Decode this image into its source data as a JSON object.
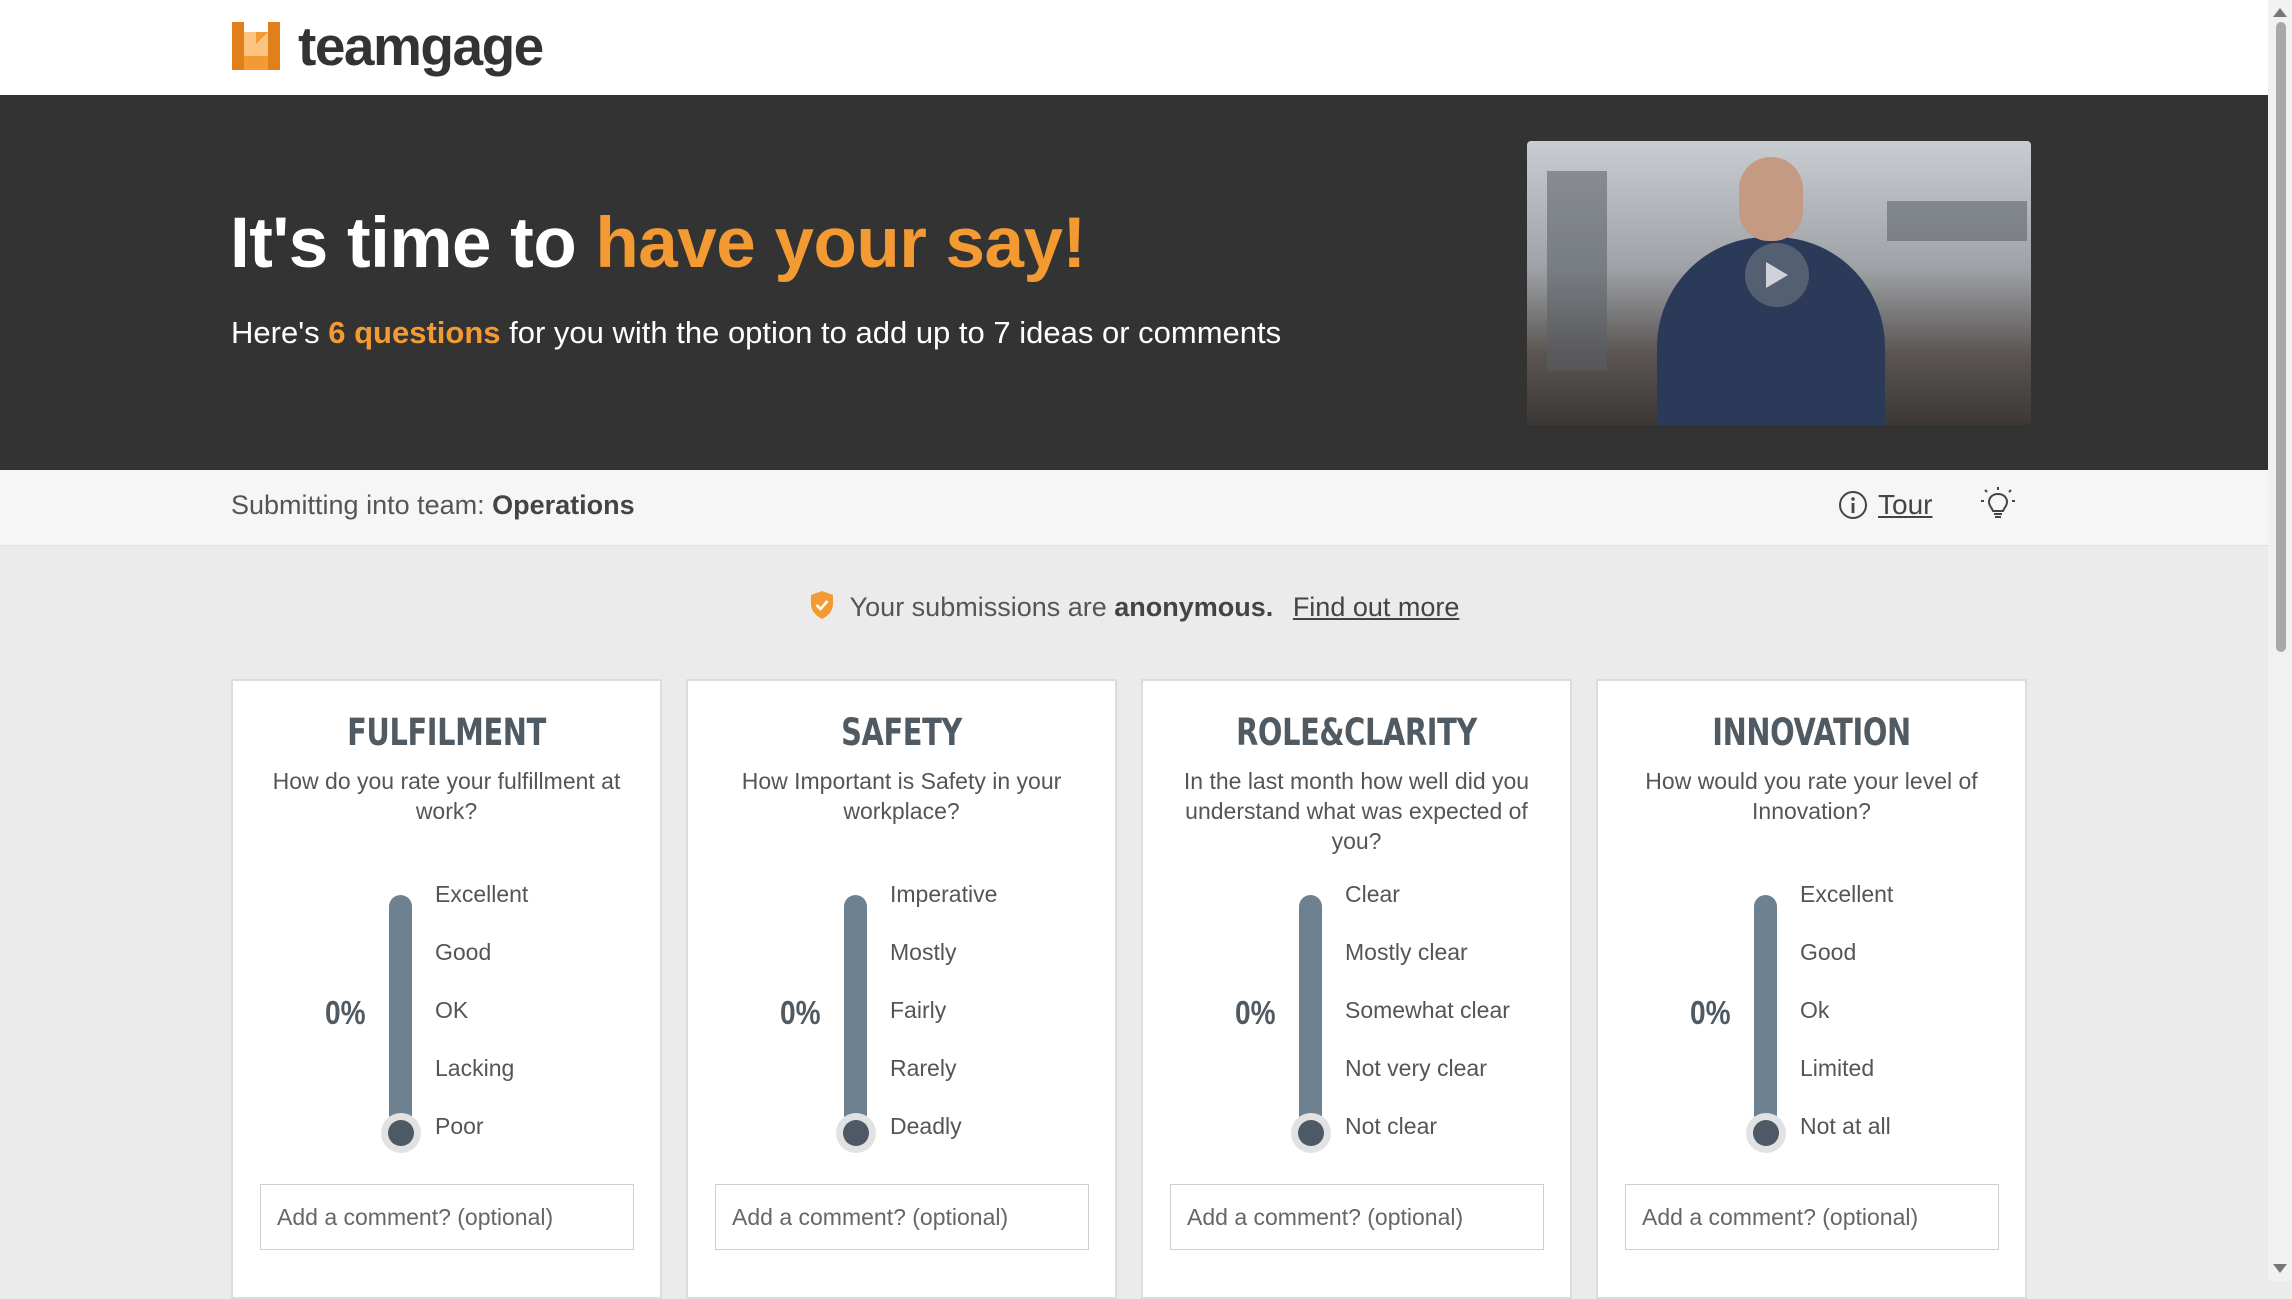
{
  "brand": {
    "name": "teamgage",
    "color_primary": "#f39b32",
    "color_dark": "#333333"
  },
  "hero": {
    "title_prefix": "It's time to ",
    "title_accent": "have your say!",
    "subtitle_prefix": "Here's ",
    "subtitle_highlight": "6 questions",
    "subtitle_suffix": " for you with the option to add up to 7 ideas or comments",
    "video_icon": "play-icon"
  },
  "teambar": {
    "label": "Submitting into team: ",
    "team": "Operations",
    "tour_label": "Tour",
    "tour_icon": "info-icon",
    "tips_icon": "lightbulb-icon"
  },
  "anonymity": {
    "text_prefix": "Your submissions are ",
    "text_bold": "anonymous.",
    "link": "Find out more",
    "icon": "shield-check-icon"
  },
  "questions": [
    {
      "title": "FULFILMENT",
      "question": "How do you rate your fulfillment at work?",
      "percent": "0%",
      "scale": [
        "Excellent",
        "Good",
        "OK",
        "Lacking",
        "Poor"
      ],
      "selected": "Poor",
      "comment_placeholder": "Add a comment? (optional)"
    },
    {
      "title": "SAFETY",
      "question": "How Important is Safety in your workplace?",
      "percent": "0%",
      "scale": [
        "Imperative",
        "Mostly",
        "Fairly",
        "Rarely",
        "Deadly"
      ],
      "selected": "Deadly",
      "comment_placeholder": "Add a comment? (optional)"
    },
    {
      "title": "ROLE&CLARITY",
      "question": "In the last month how well did you understand what was expected of you?",
      "percent": "0%",
      "scale": [
        "Clear",
        "Mostly clear",
        "Somewhat clear",
        "Not very clear",
        "Not clear"
      ],
      "selected": "Not clear",
      "comment_placeholder": "Add a comment? (optional)"
    },
    {
      "title": "INNOVATION",
      "question": "How would you rate your level of Innovation?",
      "percent": "0%",
      "scale": [
        "Excellent",
        "Good",
        "Ok",
        "Limited",
        "Not at all"
      ],
      "selected": "Not at all",
      "comment_placeholder": "Add a comment? (optional)"
    }
  ],
  "slider": {
    "track_color": "#6e8191",
    "knob_color": "#4d5965"
  }
}
